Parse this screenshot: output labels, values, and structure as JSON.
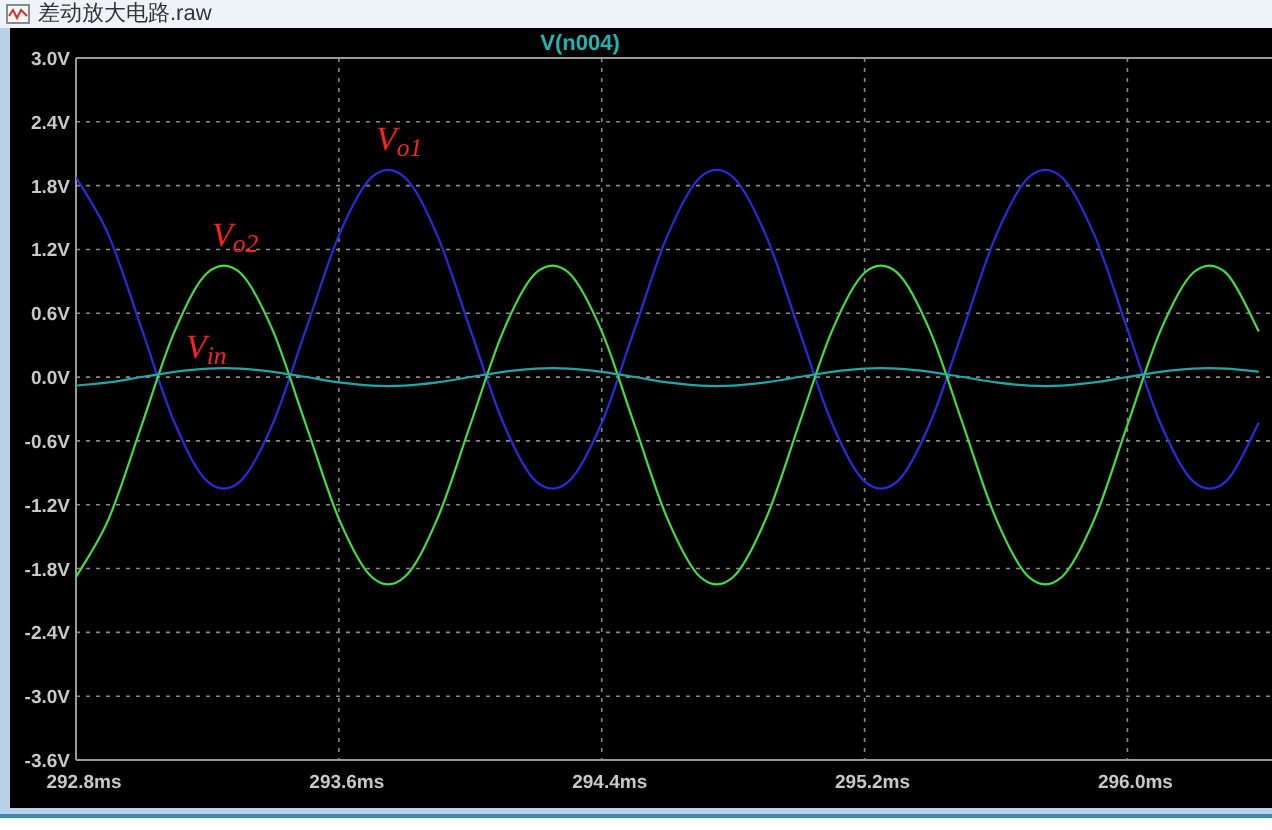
{
  "window": {
    "title": "差动放大电路.raw"
  },
  "plot": {
    "chart_data": {
      "type": "line",
      "title": "V(n004)",
      "x": [
        292.8,
        292.9,
        293.0,
        293.1,
        293.2,
        293.3,
        293.4,
        293.5,
        293.6,
        293.7,
        293.8,
        293.9,
        294.0,
        294.1,
        294.2,
        294.3,
        294.4,
        294.5,
        294.6,
        294.7,
        294.8,
        294.9,
        295.0,
        295.1,
        295.2,
        295.3,
        295.4,
        295.5,
        295.6,
        295.7,
        295.8,
        295.9,
        296.0,
        296.1,
        296.2,
        296.3,
        296.4
      ],
      "series": [
        {
          "color": "#2a2ae0",
          "values": [
            1.88,
            1.33,
            0.45,
            -0.43,
            -0.98,
            -0.98,
            -0.43,
            0.45,
            1.33,
            1.88,
            1.88,
            1.33,
            0.45,
            -0.43,
            -0.98,
            -0.98,
            -0.43,
            0.45,
            1.33,
            1.88,
            1.88,
            1.33,
            0.45,
            -0.43,
            -0.98,
            -0.98,
            -0.43,
            0.45,
            1.33,
            1.88,
            1.88,
            1.33,
            0.45,
            -0.43,
            -0.98,
            -0.98,
            -0.43
          ]
        },
        {
          "color": "#3fe03f",
          "values": [
            -1.88,
            -1.33,
            -0.45,
            0.43,
            0.98,
            0.98,
            0.43,
            -0.45,
            -1.33,
            -1.88,
            -1.88,
            -1.33,
            -0.45,
            0.43,
            0.98,
            0.98,
            0.43,
            -0.45,
            -1.33,
            -1.88,
            -1.88,
            -1.33,
            -0.45,
            0.43,
            0.98,
            0.98,
            0.43,
            -0.45,
            -1.33,
            -1.88,
            -1.88,
            -1.33,
            -0.45,
            0.43,
            0.98,
            0.98,
            0.43
          ]
        },
        {
          "color": "#1fa8a8",
          "values": [
            -0.08,
            -0.05,
            0,
            0.05,
            0.08,
            0.08,
            0.05,
            0,
            -0.05,
            -0.08,
            -0.08,
            -0.05,
            0,
            0.05,
            0.08,
            0.08,
            0.05,
            0,
            -0.05,
            -0.08,
            -0.08,
            -0.05,
            0,
            0.05,
            0.08,
            0.08,
            0.05,
            0,
            -0.05,
            -0.08,
            -0.08,
            -0.05,
            0,
            0.05,
            0.08,
            0.08,
            0.05
          ]
        }
      ],
      "grid": true,
      "xlim": [
        292.8,
        296.44
      ],
      "ylim": [
        -3.6,
        3.0
      ],
      "xticks": [
        {
          "value": 292.8,
          "label": "292.8ms"
        },
        {
          "value": 293.6,
          "label": "293.6ms"
        },
        {
          "value": 294.4,
          "label": "294.4ms"
        },
        {
          "value": 295.2,
          "label": "295.2ms"
        },
        {
          "value": 296.0,
          "label": "296.0ms"
        }
      ],
      "yticks": [
        {
          "value": 3.0,
          "label": "3.0V"
        },
        {
          "value": 2.4,
          "label": "2.4V"
        },
        {
          "value": 1.8,
          "label": "1.8V"
        },
        {
          "value": 1.2,
          "label": "1.2V"
        },
        {
          "value": 0.6,
          "label": "0.6V"
        },
        {
          "value": 0.0,
          "label": "0.0V"
        },
        {
          "value": -0.6,
          "label": "-0.6V"
        },
        {
          "value": -1.2,
          "label": "-1.2V"
        },
        {
          "value": -1.8,
          "label": "-1.8V"
        },
        {
          "value": -2.4,
          "label": "-2.4V"
        },
        {
          "value": -3.0,
          "label": "-3.0V"
        },
        {
          "value": -3.6,
          "label": "-3.6V"
        }
      ],
      "annotations": [
        "V$_{o1}$",
        "V$_{o2}$",
        "V$_{in}$"
      ]
    }
  }
}
